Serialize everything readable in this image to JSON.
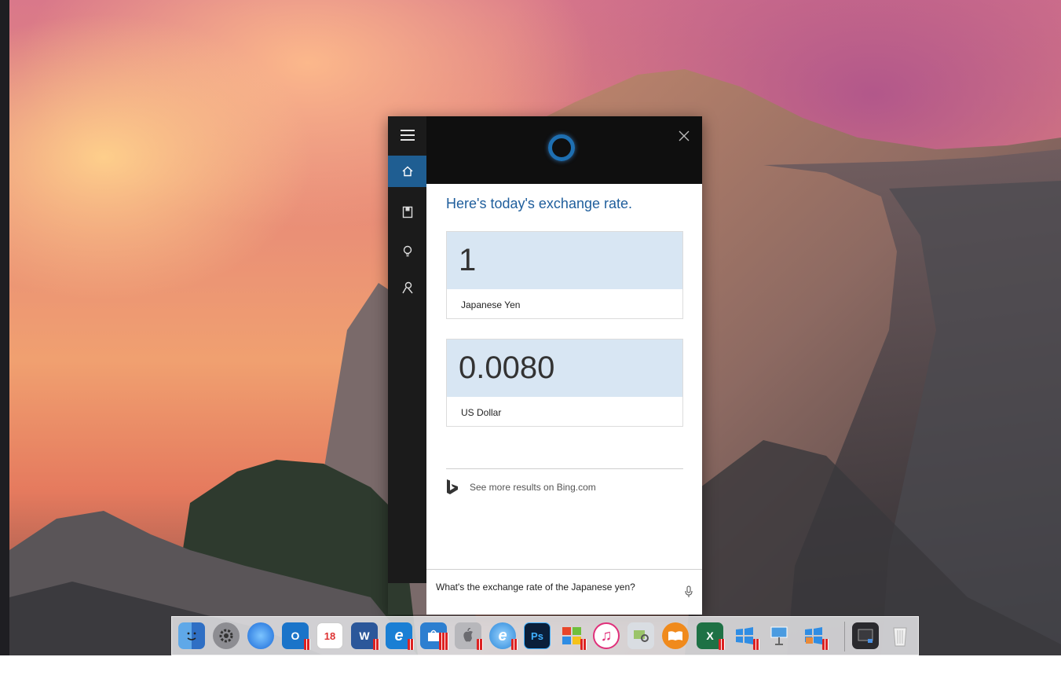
{
  "cortana": {
    "heading": "Here's today's exchange rate.",
    "from": {
      "value": "1",
      "currency": "Japanese Yen"
    },
    "to": {
      "value": "0.0080",
      "currency": "US Dollar"
    },
    "bing_link": "See more results on Bing.com",
    "query": "What's the exchange rate of the Japanese yen?",
    "accent_color": "#1f5e92",
    "sidebar_icons": [
      "hamburger-menu-icon",
      "home-icon",
      "notebook-icon",
      "lightbulb-icon",
      "feedback-icon"
    ]
  },
  "dock": {
    "apps": [
      {
        "name": "finder",
        "label": ""
      },
      {
        "name": "system-preferences",
        "label": ""
      },
      {
        "name": "safari",
        "label": ""
      },
      {
        "name": "outlook",
        "label": "O"
      },
      {
        "name": "calendar",
        "label": "18"
      },
      {
        "name": "word",
        "label": "W"
      },
      {
        "name": "edge",
        "label": "e"
      },
      {
        "name": "windows-store",
        "label": ""
      },
      {
        "name": "boot-camp",
        "label": ""
      },
      {
        "name": "internet-explorer",
        "label": "e"
      },
      {
        "name": "photoshop",
        "label": "Ps"
      },
      {
        "name": "windows-xp",
        "label": ""
      },
      {
        "name": "itunes",
        "label": "♫"
      },
      {
        "name": "preview",
        "label": ""
      },
      {
        "name": "ibooks",
        "label": ""
      },
      {
        "name": "excel",
        "label": "X"
      },
      {
        "name": "windows-10",
        "label": ""
      },
      {
        "name": "keynote",
        "label": ""
      },
      {
        "name": "windows-control-panel",
        "label": ""
      },
      {
        "name": "parallels-desktop",
        "label": ""
      },
      {
        "name": "trash",
        "label": ""
      }
    ]
  }
}
